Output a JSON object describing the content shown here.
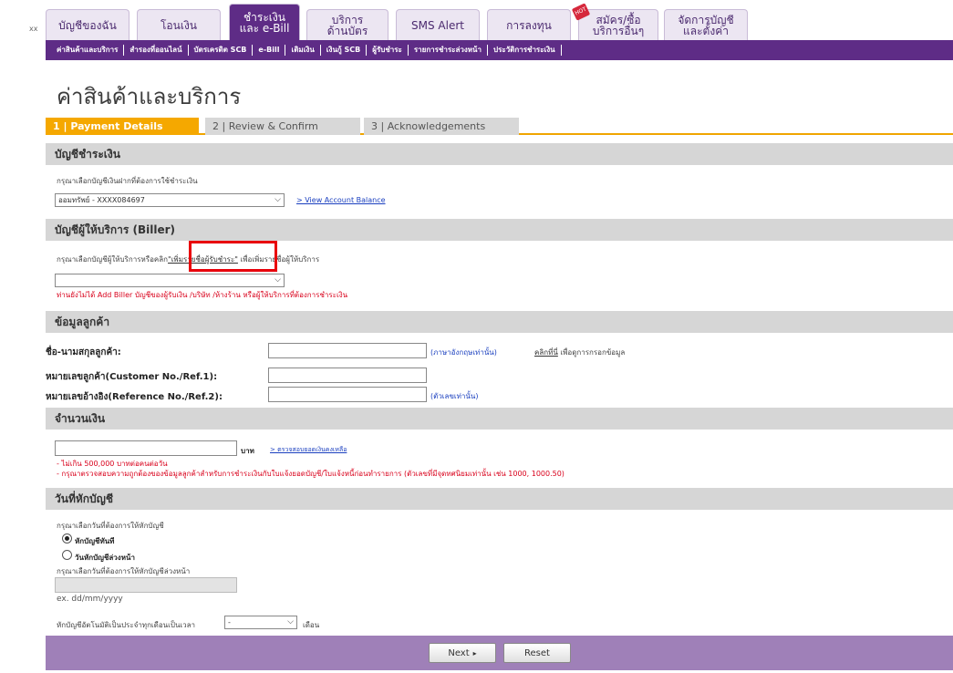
{
  "topnav": {
    "prefix": "xx",
    "tabs": [
      {
        "label": "บัญชีของฉัน"
      },
      {
        "label": "โอนเงิน"
      },
      {
        "line1": "ชำระเงิน",
        "line2": "และ e-Bill"
      },
      {
        "line1": "บริการ",
        "line2": "ด้านบัตร"
      },
      {
        "label": "SMS Alert"
      },
      {
        "label": "การลงทุน"
      },
      {
        "line1": "สมัคร/ซื้อ",
        "line2": "บริการอื่นๆ"
      },
      {
        "line1": "จัดการบัญชี",
        "line2": "และตั้งค่า"
      }
    ],
    "hot_badge": "HOT"
  },
  "subnav": {
    "items": [
      "ค่าสินค้าและบริการ",
      "สำรองที่ออนไลน์",
      "บัตรเครดิต SCB",
      "e-Bill",
      "เติมเงิน",
      "เงินกู้ SCB",
      "ผู้รับชำระ",
      "รายการชำระล่วงหน้า",
      "ประวัติการชำระเงิน"
    ]
  },
  "page_title": "ค่าสินค้าและบริการ",
  "steps": [
    "1 | Payment Details",
    "2 | Review & Confirm",
    "3 | Acknowledgements"
  ],
  "account_section": {
    "header": "บัญชีชำระเงิน",
    "instruction": "กรุณาเลือกบัญชีเงินฝากที่ต้องการใช้ชำระเงิน",
    "selected_account": "ออมทรัพย์ - XXXX084697",
    "view_balance_link": "> View Account Balance"
  },
  "biller_section": {
    "header": "บัญชีผู้ให้บริการ (Biller)",
    "instruction_before": "กรุณาเลือกบัญชีผู้ให้บริการหรือคลิก",
    "add_payee_link": "\"เพิ่มรายชื่อผู้รับชำระ\"",
    "instruction_after": "เพื่อเพิ่มรายชื่อผู้ให้บริการ",
    "selected_biller": "",
    "warning": "ท่านยังไม่ได้ Add Biller บัญชีของผู้รับเงิน /บริษัท /ห้างร้าน หรือผู้ให้บริการที่ต้องการชำระเงิน"
  },
  "customer_section": {
    "header": "ข้อมูลลูกค้า",
    "name_label": "ชื่อ-นามสกุลลูกค้า:",
    "name_value": "",
    "name_hint": "(ภาษาอังกฤษเท่านั้น)",
    "click_here": "คลิกที่นี่",
    "click_hint": "เพื่อดูการกรอกข้อมูล",
    "ref1_label": "หมายเลขลูกค้า(Customer No./Ref.1):",
    "ref1_value": "",
    "ref2_label": "หมายเลขอ้างอิง(Reference No./Ref.2):",
    "ref2_value": "",
    "ref2_hint": "(ตัวเลขเท่านั้น)"
  },
  "amount_section": {
    "header": "จำนวนเงิน",
    "amount_value": "",
    "currency": "บาท",
    "check_link": "> ตรวจสอบยอดเงินคงเหลือ",
    "note1": "- ไม่เกิน 500,000 บาทต่อคนต่อวัน",
    "note2": "- กรุณาตรวจสอบความถูกต้องของข้อมูลลูกค้าสำหรับการชำระเงินกับใบแจ้งยอดบัญชี/ใบแจ้งหนี้ก่อนทำรายการ (ตัวเลขที่มีจุดทศนิยมเท่านั้น เช่น 1000, 1000.50)"
  },
  "date_section": {
    "header": "วันที่หักบัญชี",
    "instruction": "กรุณาเลือกวันที่ต้องการให้หักบัญชี",
    "option_now": "หักบัญชีทันที",
    "option_future": "วันหักบัญชีล่วงหน้า",
    "future_instruction": "กรุณาเลือกวันที่ต้องการให้หักบัญชีล่วงหน้า",
    "date_value": "",
    "date_format": "ex. dd/mm/yyyy",
    "recurring_label": "หักบัญชีอัตโนมัติเป็นประจำทุกเดือนเป็นเวลา",
    "recurring_value": "-",
    "recurring_unit": "เดือน"
  },
  "buttons": {
    "next": "Next",
    "reset": "Reset"
  }
}
